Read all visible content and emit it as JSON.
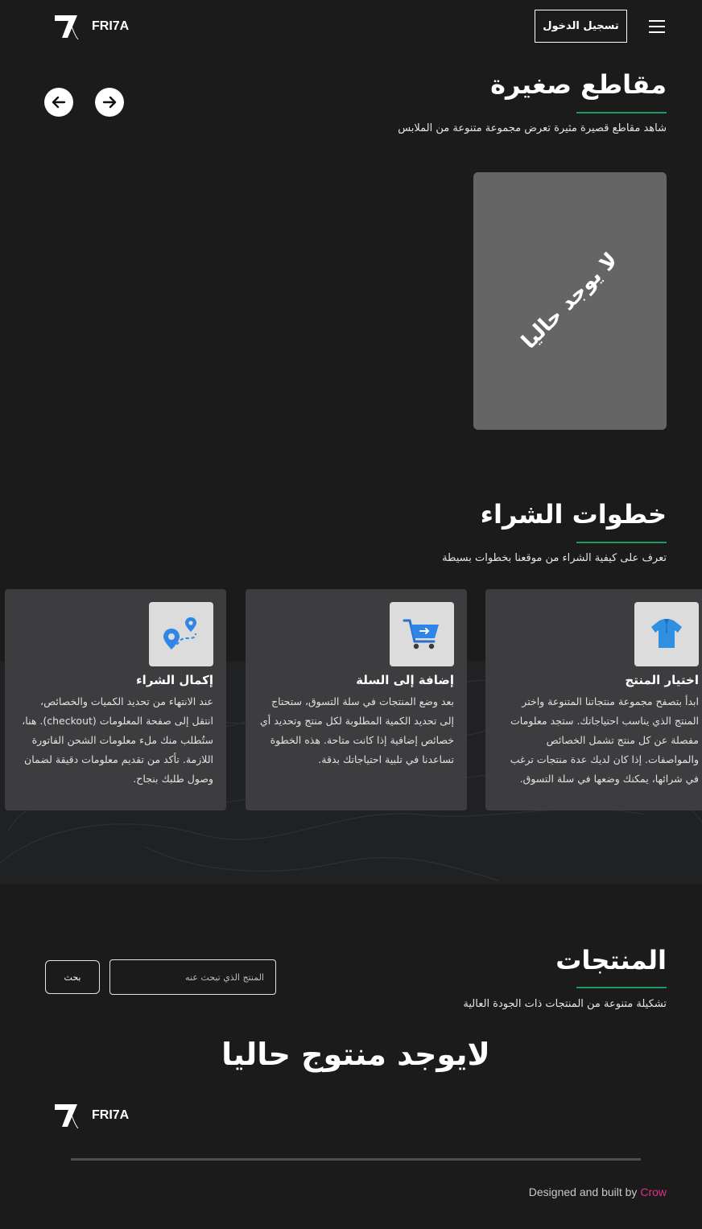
{
  "header": {
    "brand": "FRI7A",
    "login_label": "تسجيل الدخول"
  },
  "shorts": {
    "title": "مقاطع صغيرة",
    "subtitle": "شاهد مقاطع قصيرة مثيرة تعرض مجموعة متنوعة من الملابس",
    "empty_card_text": "لا يوجد حاليا"
  },
  "steps": {
    "title": "خطوات الشراء",
    "subtitle": "تعرف على كيفية الشراء من موقعنا بخطوات بسيطة",
    "items": [
      {
        "title": "اختيار المنتج",
        "icon": "shirt-icon",
        "description": "ابدأ بتصفح مجموعة منتجاتنا المتنوعة واختر المنتج الذي يناسب احتياجاتك. ستجد معلومات مفصلة عن كل منتج تشمل الخصائص والمواصفات. إذا كان لديك عدة منتجات ترغب في شرائها، يمكنك وضعها في سلة التسوق."
      },
      {
        "title": "إضافة إلى السلة",
        "icon": "cart-icon",
        "description": "بعد وضع المنتجات في سلة التسوق، ستحتاج إلى تحديد الكمية المطلوبة لكل منتج وتحديد أي خصائص إضافية إذا كانت متاحة. هذه الخطوة تساعدنا في تلبية احتياجاتك بدقة."
      },
      {
        "title": "إكمال الشراء",
        "icon": "route-pin-icon",
        "description": "عند الانتهاء من تحديد الكميات والخصائص، انتقل إلى صفحة المعلومات (checkout). هنا، ستُطلب منك ملء معلومات الشحن الفاتورة اللازمة. تأكد من تقديم معلومات دقيقة لضمان وصول طلبك بنجاح."
      }
    ]
  },
  "products": {
    "title": "المنتجات",
    "subtitle": "تشكيلة متنوعة من المنتجات ذات الجودة العالية",
    "search_placeholder": "المنتج الذي تبحث عنه",
    "search_button": "بحث",
    "empty_text": "لايوجد منتوج حاليا"
  },
  "footer": {
    "brand": "FRI7A",
    "credit_prefix": "Designed and built by",
    "credit_name": "Crow"
  },
  "colors": {
    "background": "#1b1b1c",
    "accent_underline": "#1c9b63",
    "card": "#3d3d3f",
    "credit_name": "#e0308a"
  }
}
